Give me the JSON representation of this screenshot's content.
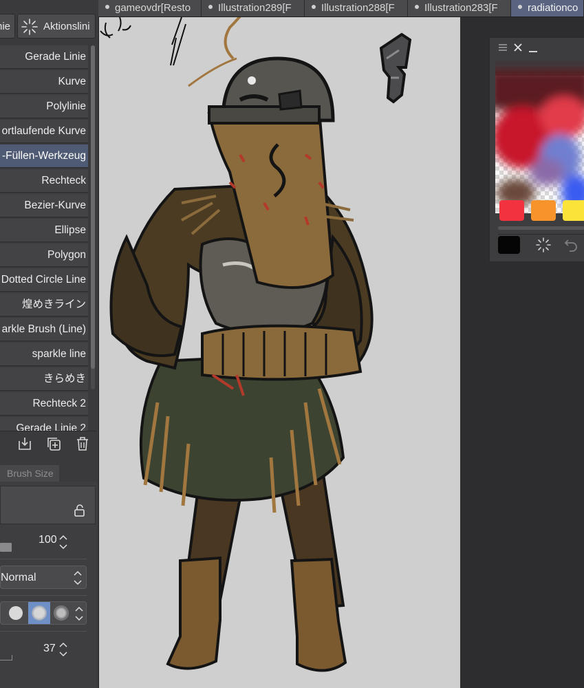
{
  "tabs": [
    {
      "label": "gameovdr[Resto"
    },
    {
      "label": "Illustration289[F"
    },
    {
      "label": "Illustration288[F"
    },
    {
      "label": "Illustration283[F"
    },
    {
      "label": "radiationco"
    }
  ],
  "toolbar": {
    "mode_left_label": "nie",
    "mode_right_label": "Aktionslini"
  },
  "sub_tools": [
    {
      "label": "Gerade Linie"
    },
    {
      "label": "Kurve"
    },
    {
      "label": "Polylinie"
    },
    {
      "label": "ortlaufende Kurve"
    },
    {
      "label": "-Füllen-Werkzeug"
    },
    {
      "label": "Rechteck"
    },
    {
      "label": "Bezier-Kurve"
    },
    {
      "label": "Ellipse"
    },
    {
      "label": "Polygon"
    },
    {
      "label": "Dotted Circle Line"
    },
    {
      "label": "煌めきライン"
    },
    {
      "label": "arkle Brush (Line)"
    },
    {
      "label": "sparkle line"
    },
    {
      "label": "きらめき"
    },
    {
      "label": "Rechteck 2"
    },
    {
      "label": "Gerade Linie 2"
    }
  ],
  "selected_tool_index": 4,
  "properties": {
    "tab_label": "Brush Size",
    "opacity_value": "100",
    "blend_mode": "Normal",
    "size_value": "37"
  },
  "color_panel": {
    "swatches": [
      "#f2323f",
      "#f7932b",
      "#fbe33a"
    ],
    "current_color": "#050505"
  },
  "colors": {
    "selection": "#4f5a74",
    "canvas_bg": "#cfcfd0"
  }
}
